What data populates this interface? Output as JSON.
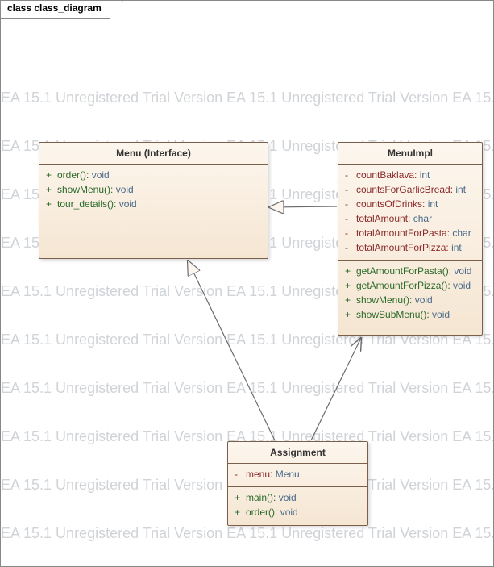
{
  "diagram": {
    "tab_label": "class class_diagram",
    "watermark_line": "EA 15.1 Unregistered Trial Version   EA 15.1 Unregistered Trial Version   EA 15.1 Unregistered Tri"
  },
  "classes": {
    "menu": {
      "title": "Menu (Interface)",
      "methods": [
        {
          "vis": "+",
          "name": "order()",
          "ret": "void"
        },
        {
          "vis": "+",
          "name": "showMenu()",
          "ret": "void"
        },
        {
          "vis": "+",
          "name": "tour_details()",
          "ret": "void"
        }
      ]
    },
    "menuImpl": {
      "title": "MenuImpl",
      "attrs": [
        {
          "vis": "-",
          "name": "countBaklava",
          "type": "int"
        },
        {
          "vis": "-",
          "name": "countsForGarlicBread",
          "type": "int"
        },
        {
          "vis": "-",
          "name": "countsOfDrinks",
          "type": "int"
        },
        {
          "vis": "-",
          "name": "totalAmount",
          "type": "char"
        },
        {
          "vis": "-",
          "name": "totalAmountForPasta",
          "type": "char"
        },
        {
          "vis": "-",
          "name": "totalAmountForPizza",
          "type": "int"
        }
      ],
      "methods": [
        {
          "vis": "+",
          "name": "getAmountForPasta()",
          "ret": "void"
        },
        {
          "vis": "+",
          "name": "getAmountForPizza()",
          "ret": "void"
        },
        {
          "vis": "+",
          "name": "showMenu()",
          "ret": "void"
        },
        {
          "vis": "+",
          "name": "showSubMenu()",
          "ret": "void"
        }
      ]
    },
    "assignment": {
      "title": "Assignment",
      "attrs": [
        {
          "vis": "-",
          "name": "menu",
          "type": "Menu"
        }
      ],
      "methods": [
        {
          "vis": "+",
          "name": "main()",
          "ret": "void"
        },
        {
          "vis": "+",
          "name": "order()",
          "ret": "void"
        }
      ]
    }
  },
  "connectors": [
    {
      "kind": "realization",
      "from": "menuImpl",
      "to": "menu"
    },
    {
      "kind": "dependency",
      "from": "assignment",
      "to": "menu"
    },
    {
      "kind": "dependency",
      "from": "assignment",
      "to": "menuImpl"
    }
  ],
  "chart_data": {
    "type": "uml_class_diagram",
    "classes": [
      {
        "name": "Menu",
        "stereotype": "Interface",
        "attributes": [],
        "operations": [
          "+ order(): void",
          "+ showMenu(): void",
          "+ tour_details(): void"
        ]
      },
      {
        "name": "MenuImpl",
        "attributes": [
          "- countBaklava: int",
          "- countsForGarlicBread: int",
          "- countsOfDrinks: int",
          "- totalAmount: char",
          "- totalAmountForPasta: char",
          "- totalAmountForPizza: int"
        ],
        "operations": [
          "+ getAmountForPasta(): void",
          "+ getAmountForPizza(): void",
          "+ showMenu(): void",
          "+ showSubMenu(): void"
        ]
      },
      {
        "name": "Assignment",
        "attributes": [
          "- menu: Menu"
        ],
        "operations": [
          "+ main(): void",
          "+ order(): void"
        ]
      }
    ],
    "relationships": [
      {
        "from": "MenuImpl",
        "to": "Menu",
        "type": "realization"
      },
      {
        "from": "Assignment",
        "to": "Menu",
        "type": "dependency"
      },
      {
        "from": "Assignment",
        "to": "MenuImpl",
        "type": "dependency"
      }
    ]
  }
}
